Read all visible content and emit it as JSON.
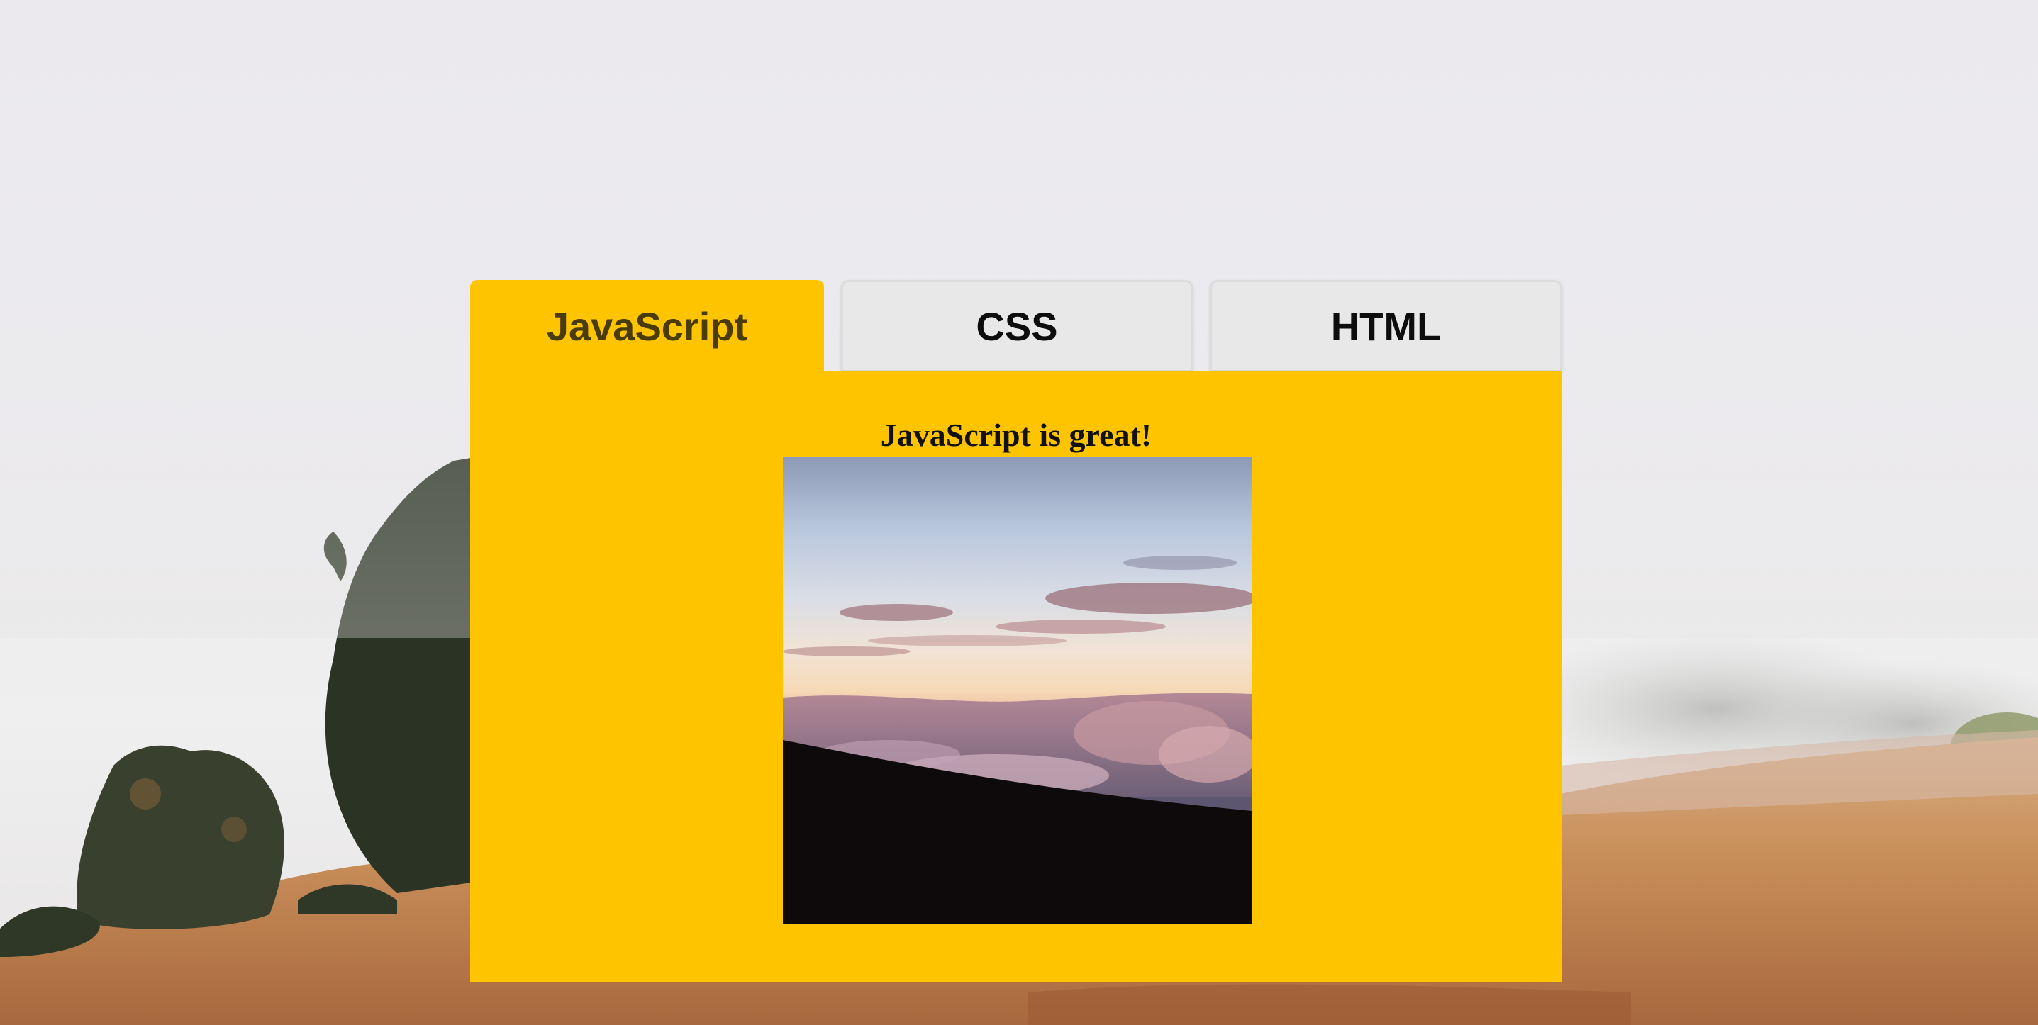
{
  "tabs": [
    {
      "label": "JavaScript",
      "active": true
    },
    {
      "label": "CSS",
      "active": false
    },
    {
      "label": "HTML",
      "active": false
    }
  ],
  "panel": {
    "heading": "JavaScript is great!",
    "image_alt": "sunset-over-clouds-photo"
  },
  "colors": {
    "active_tab": "#fec400",
    "inactive_tab": "#e8e8e8",
    "panel": "#fec400"
  }
}
